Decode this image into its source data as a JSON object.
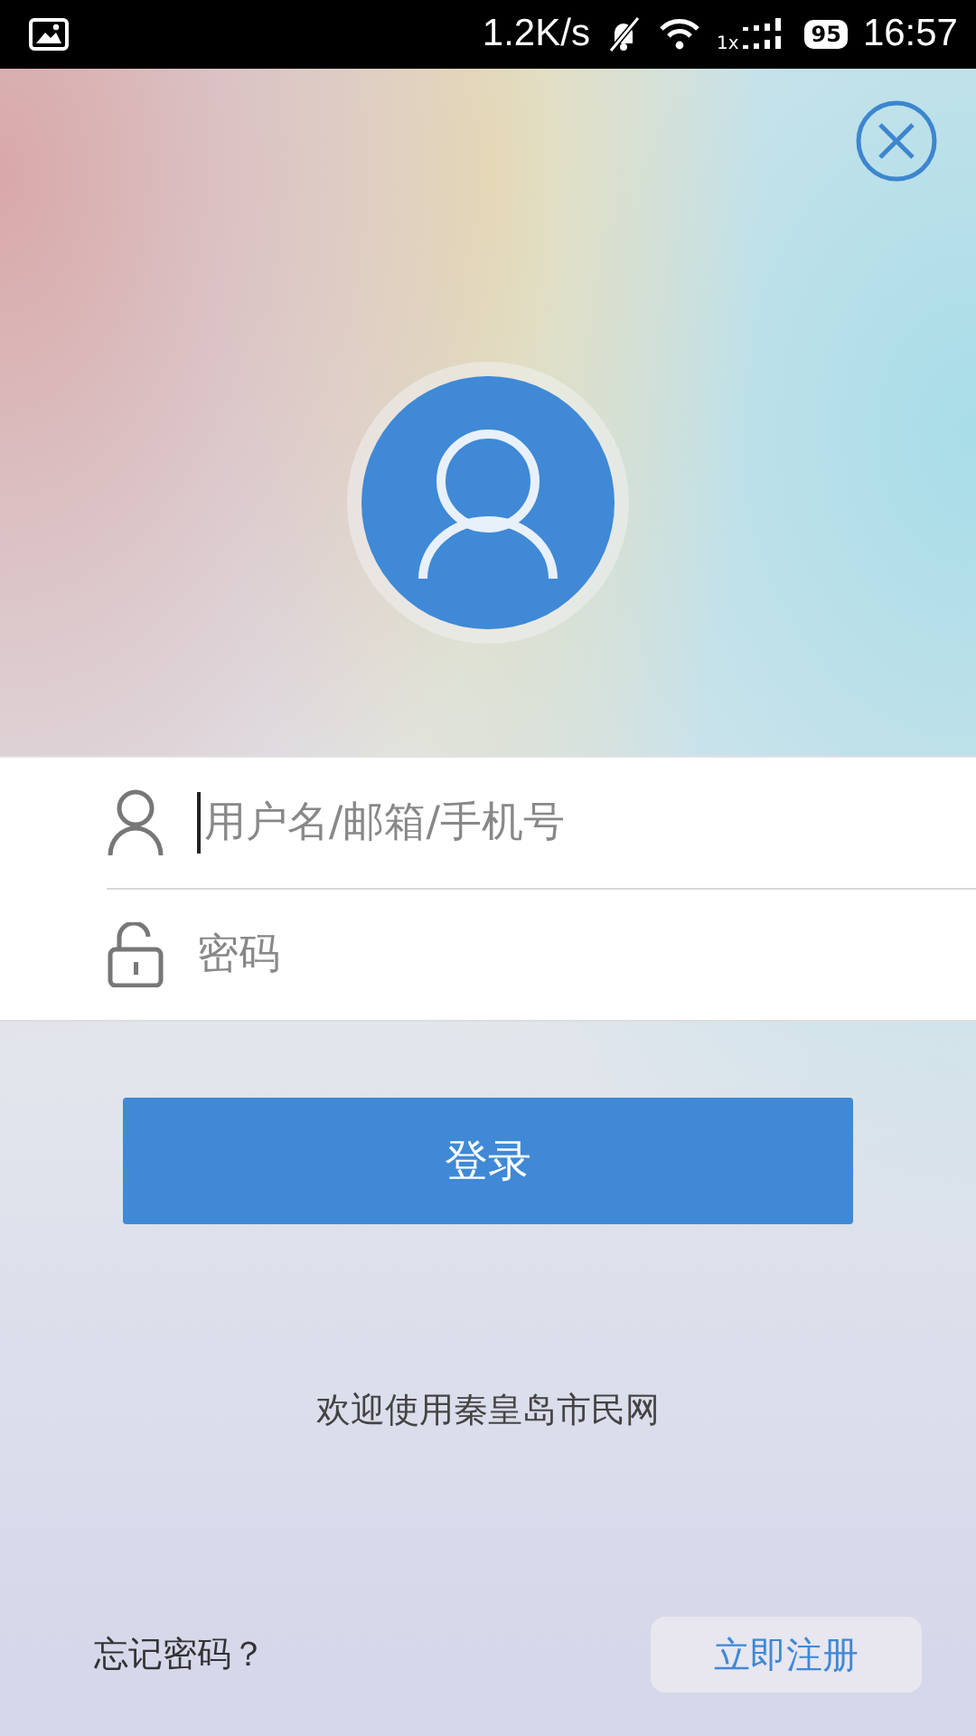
{
  "status_bar": {
    "speed": "1.2K/s",
    "network": "1x",
    "battery": "95",
    "time": "16:57"
  },
  "form": {
    "username": {
      "placeholder": "用户名/邮箱/手机号",
      "focused": true
    },
    "password": {
      "placeholder": "密码"
    }
  },
  "login_button": "登录",
  "welcome": "欢迎使用秦皇岛市民网",
  "forgot_password": "忘记密码？",
  "register_button": "立即注册"
}
